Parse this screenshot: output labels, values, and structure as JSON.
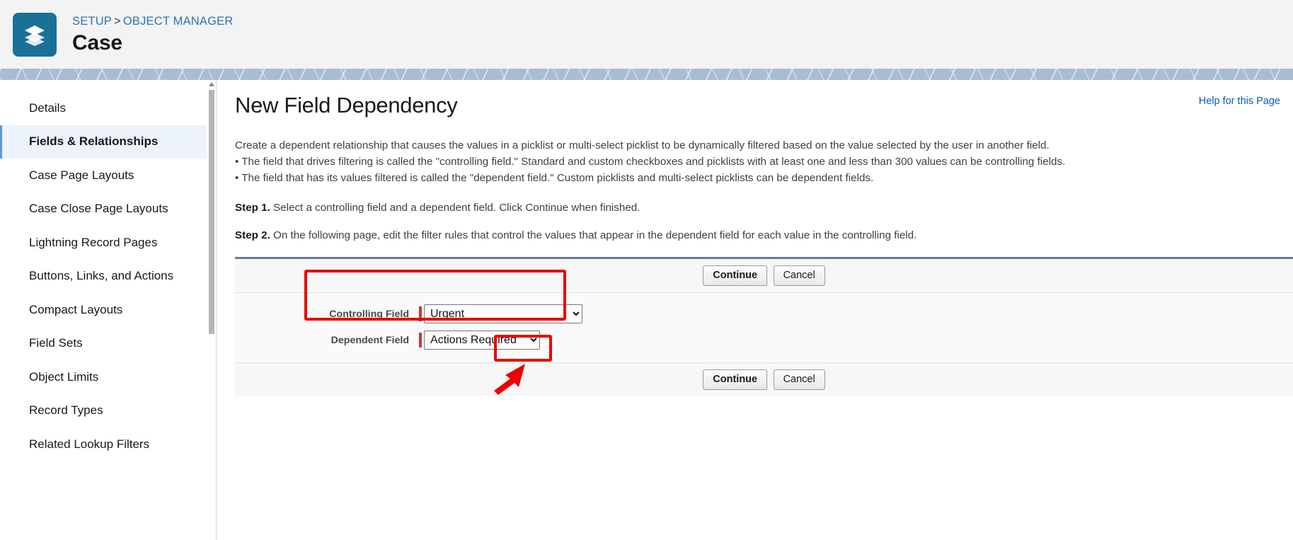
{
  "header": {
    "icon_name": "case-object-icon",
    "icon_color": "#1b7098",
    "breadcrumb_setup": "SETUP",
    "breadcrumb_separator": ">",
    "breadcrumb_object_manager": "OBJECT MANAGER",
    "title": "Case"
  },
  "sidebar": {
    "items": [
      {
        "label": "Details",
        "active": false
      },
      {
        "label": "Fields & Relationships",
        "active": true
      },
      {
        "label": "Case Page Layouts",
        "active": false
      },
      {
        "label": "Case Close Page Layouts",
        "active": false
      },
      {
        "label": "Lightning Record Pages",
        "active": false
      },
      {
        "label": "Buttons, Links, and Actions",
        "active": false
      },
      {
        "label": "Compact Layouts",
        "active": false
      },
      {
        "label": "Field Sets",
        "active": false
      },
      {
        "label": "Object Limits",
        "active": false
      },
      {
        "label": "Record Types",
        "active": false
      },
      {
        "label": "Related Lookup Filters",
        "active": false
      }
    ]
  },
  "main": {
    "title": "New Field Dependency",
    "help_link": "Help for this Page",
    "intro": "Create a dependent relationship that causes the values in a picklist or multi-select picklist to be dynamically filtered based on the value selected by the user in another field.",
    "bullet_1": "• The field that drives filtering is called the \"controlling field.\" Standard and custom checkboxes and picklists with at least one and less than 300 values can be controlling fields.",
    "bullet_2": "• The field that has its values filtered is called the \"dependent field.\" Custom picklists and multi-select picklists can be dependent fields.",
    "step1_label": "Step 1.",
    "step1_text": "Select a controlling field and a dependent field. Click Continue when finished.",
    "step2_label": "Step 2.",
    "step2_text": "On the following page, edit the filter rules that control the values that appear in the dependent field for each value in the controlling field."
  },
  "form": {
    "continue_label": "Continue",
    "cancel_label": "Cancel",
    "controlling_field": {
      "label": "Controlling Field",
      "value": "Urgent",
      "options": [
        "Urgent"
      ]
    },
    "dependent_field": {
      "label": "Dependent Field",
      "value": "Actions Required",
      "options": [
        "Actions Required"
      ]
    }
  },
  "annotations": {
    "color": "#ec0000",
    "field_box_name": "field-selection-highlight",
    "continue_box_name": "continue-button-highlight",
    "arrow_name": "pointer-arrow"
  }
}
